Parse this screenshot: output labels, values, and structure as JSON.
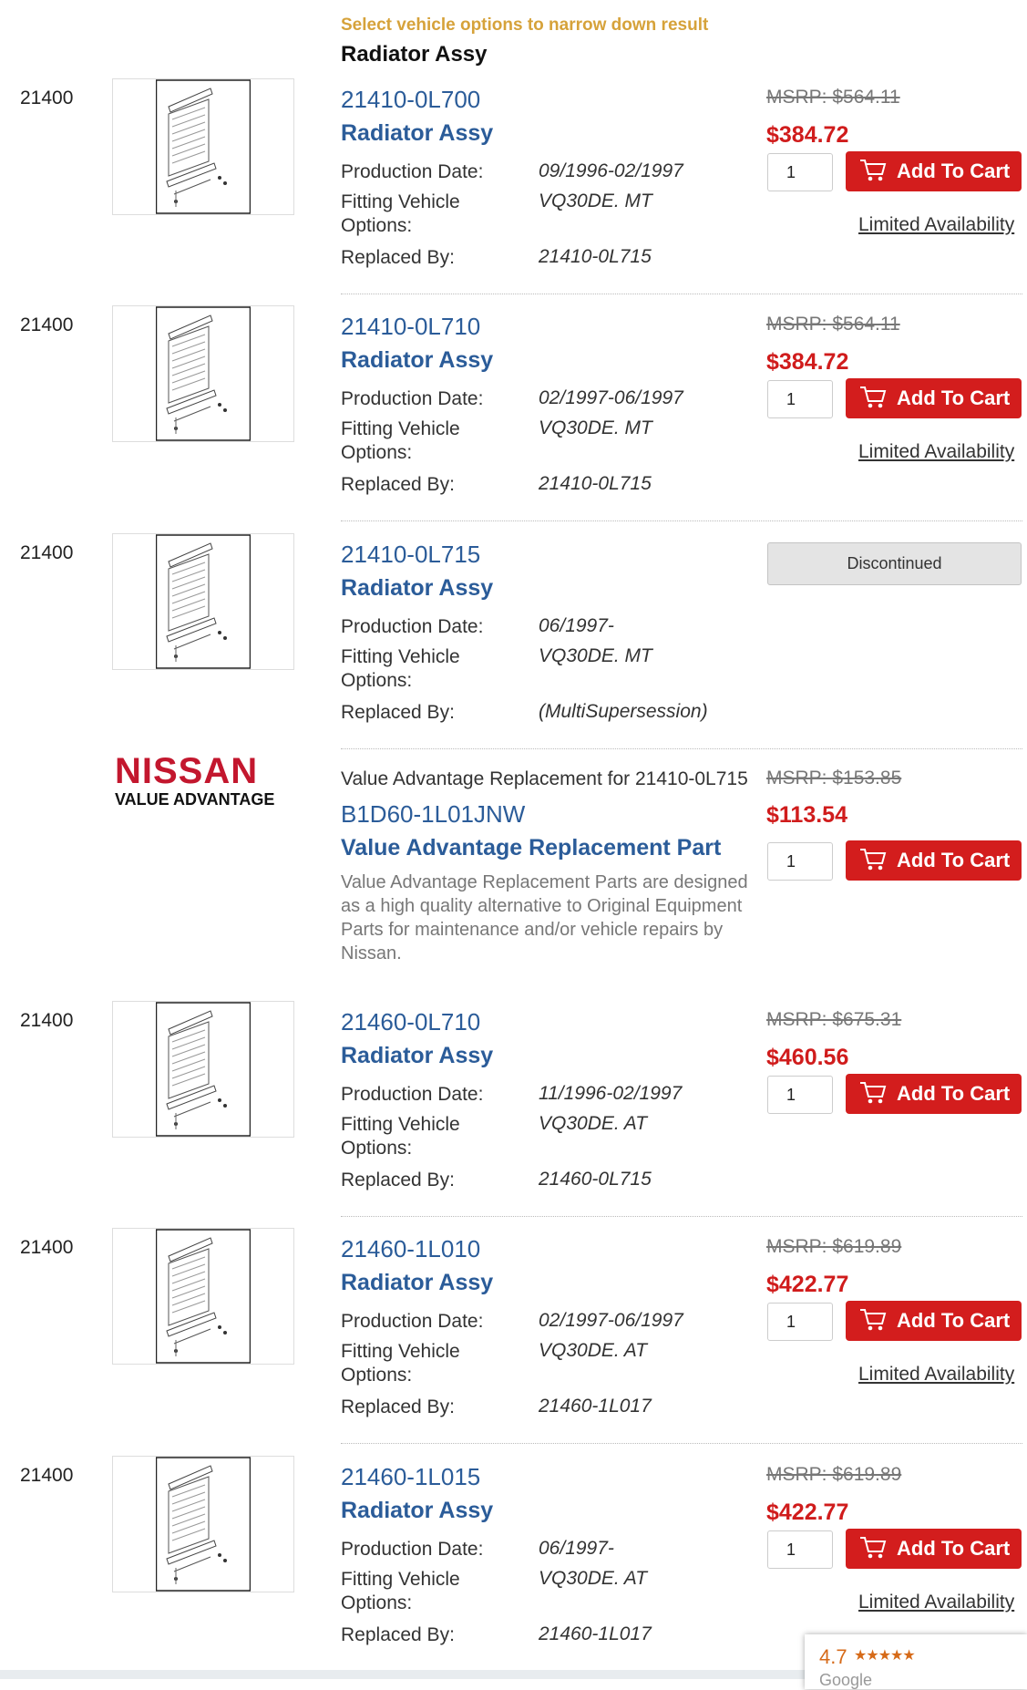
{
  "header": {
    "hint": "Select vehicle options to narrow down result",
    "title": "Radiator Assy"
  },
  "labels": {
    "production_date": "Production Date:",
    "fitting_vehicle": "Fitting Vehicle",
    "options": "Options:",
    "replaced_by": "Replaced By:",
    "add_to_cart": "Add To Cart",
    "qty_default": "1"
  },
  "parts": [
    {
      "ref": "21400",
      "number": "21410-0L700",
      "name": "Radiator Assy",
      "msrp": "MSRP: $564.11",
      "price": "$384.72",
      "production": "09/1996-02/1997",
      "fitting": "VQ30DE. MT",
      "replaced": "21410-0L715",
      "availability": "Limited Availability"
    },
    {
      "ref": "21400",
      "number": "21410-0L710",
      "name": "Radiator Assy",
      "msrp": "MSRP: $564.11",
      "price": "$384.72",
      "production": "02/1997-06/1997",
      "fitting": "VQ30DE. MT",
      "replaced": "21410-0L715",
      "availability": "Limited Availability"
    },
    {
      "ref": "21400",
      "number": "21410-0L715",
      "name": "Radiator Assy",
      "status": "Discontinued",
      "production": "06/1997-",
      "fitting": "VQ30DE. MT",
      "replaced": "(MultiSupersession)"
    },
    {
      "ref": "21400",
      "number": "21460-0L710",
      "name": "Radiator Assy",
      "msrp": "MSRP: $675.31",
      "price": "$460.56",
      "production": "11/1996-02/1997",
      "fitting": "VQ30DE. AT",
      "replaced": "21460-0L715"
    },
    {
      "ref": "21400",
      "number": "21460-1L010",
      "name": "Radiator Assy",
      "msrp": "MSRP: $619.89",
      "price": "$422.77",
      "production": "02/1997-06/1997",
      "fitting": "VQ30DE. AT",
      "replaced": "21460-1L017",
      "availability": "Limited Availability"
    },
    {
      "ref": "21400",
      "number": "21460-1L015",
      "name": "Radiator Assy",
      "msrp": "MSRP: $619.89",
      "price": "$422.77",
      "production": "06/1997-",
      "fitting": "VQ30DE. AT",
      "replaced": "21460-1L017",
      "availability": "Limited Availability"
    }
  ],
  "value_advantage": {
    "logo_top": "NISSAN",
    "logo_bottom": "VALUE ADVANTAGE",
    "title": "Value Advantage Replacement for 21410-0L715",
    "number": "B1D60-1L01JNW",
    "name": "Value Advantage Replacement Part",
    "msrp": "MSRP: $153.85",
    "price": "$113.54",
    "description": "Value Advantage Replacement Parts are designed as a high quality alternative to Original Equipment Parts for maintenance and/or vehicle repairs by Nissan."
  },
  "rating": {
    "score": "4.7",
    "stars": "★★★★★",
    "label": "Google"
  },
  "colors": {
    "link_blue": "#2b5c99",
    "price_red": "#d01c1c",
    "button_red": "#d31d1d",
    "hint_gold": "#d6a23a",
    "brand_red": "#c3172e"
  }
}
